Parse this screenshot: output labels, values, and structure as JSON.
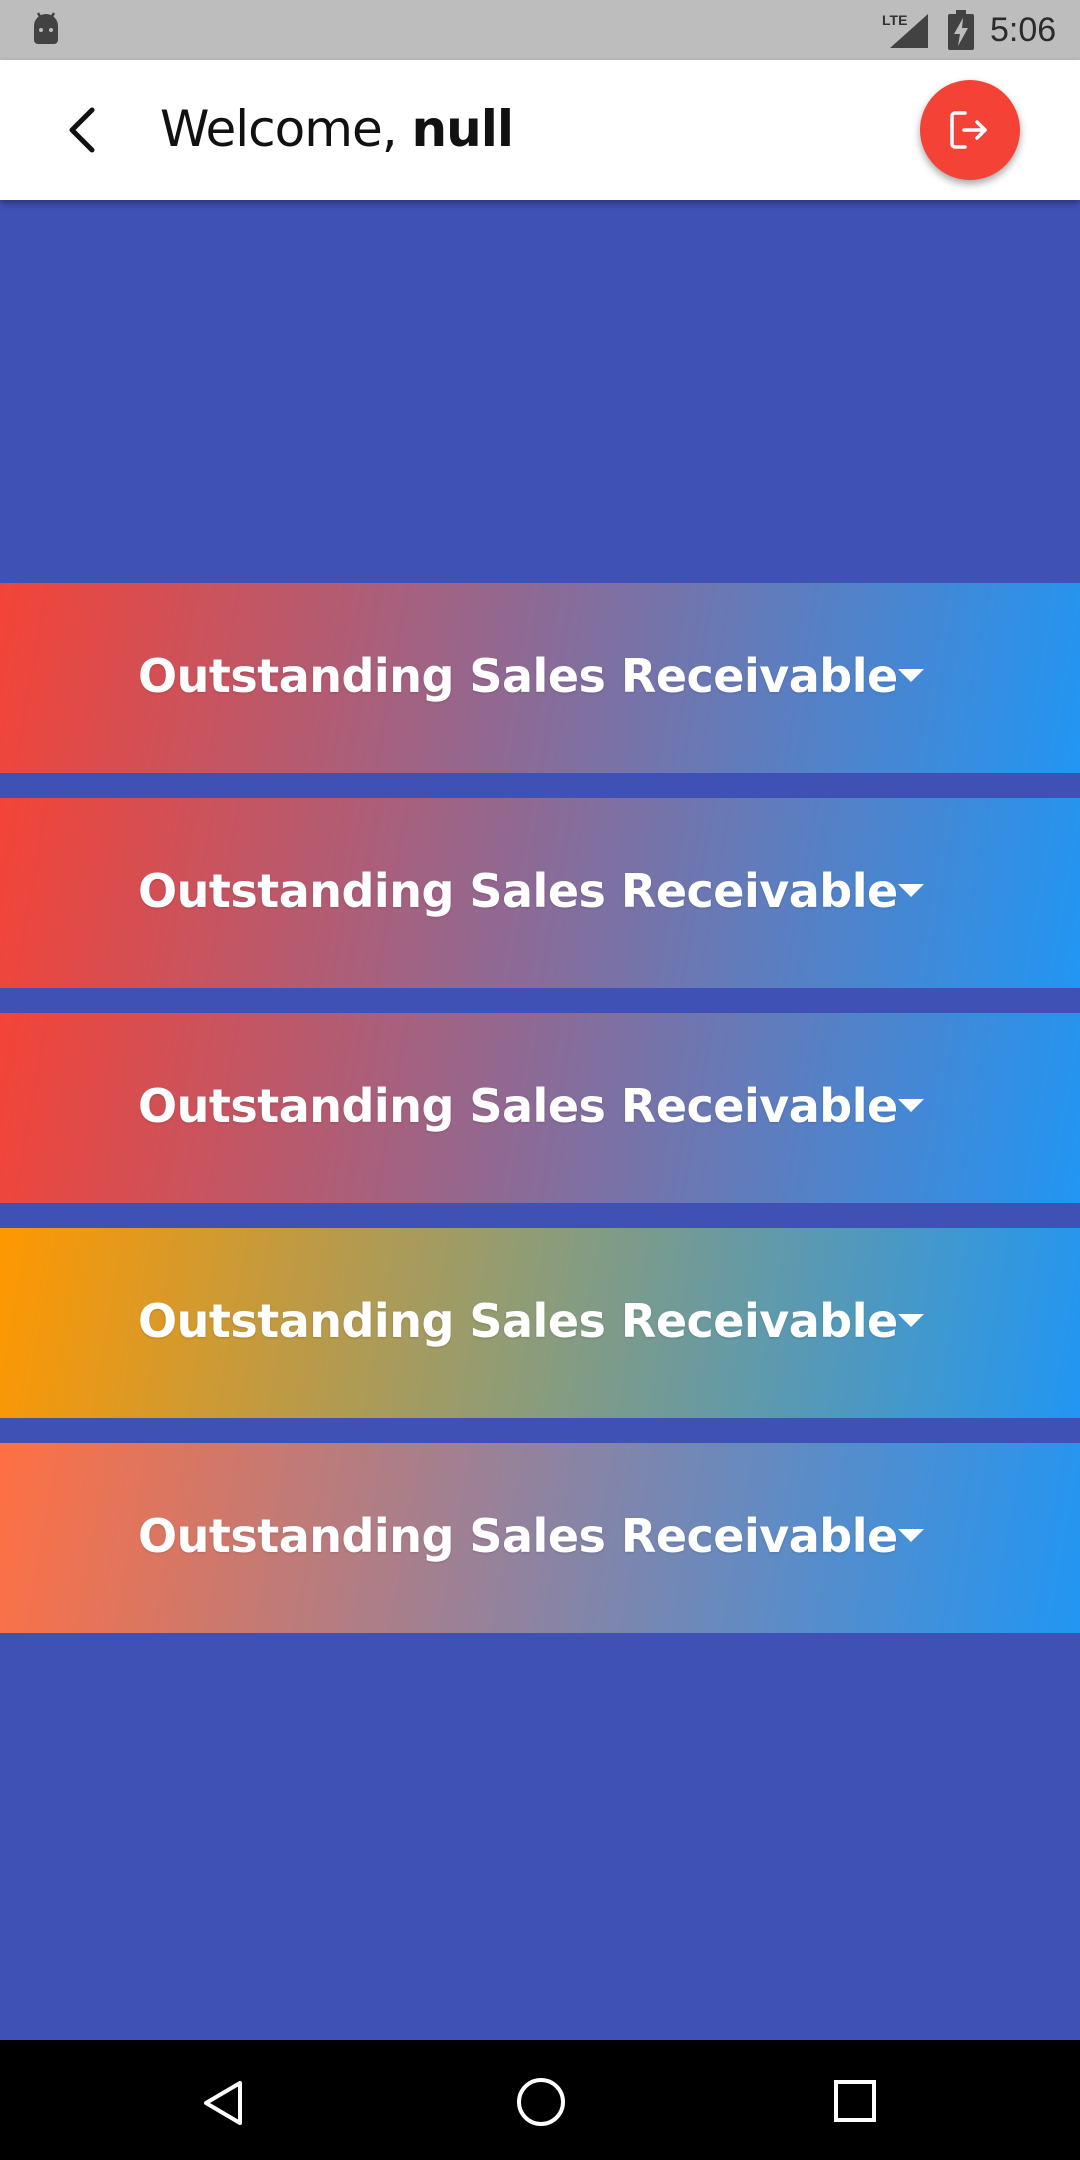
{
  "status_bar": {
    "network": "LTE",
    "time": "5:06",
    "icons": [
      "android-icon",
      "signal-icon",
      "battery-charging-icon"
    ]
  },
  "app_bar": {
    "welcome_prefix": "Welcome,",
    "user_name": "null",
    "back_icon": "back-arrow-icon",
    "logout_icon": "logout-icon",
    "logout_color": "#f44336"
  },
  "cards": [
    {
      "title": "Outstanding Sales Receivable",
      "gradient_start": "#f44336",
      "gradient_end": "#2196f3"
    },
    {
      "title": "Outstanding Sales Receivable",
      "gradient_start": "#f44336",
      "gradient_end": "#2196f3"
    },
    {
      "title": "Outstanding Sales Receivable",
      "gradient_start": "#f44336",
      "gradient_end": "#2196f3"
    },
    {
      "title": "Outstanding Sales Receivable",
      "gradient_start": "#ff9800",
      "gradient_end": "#2196f3"
    },
    {
      "title": "Outstanding Sales Receivable",
      "gradient_start": "#ff7043",
      "gradient_end": "#2196f3"
    }
  ],
  "colors": {
    "background": "#3f51b5",
    "app_bar": "#ffffff",
    "status_bar": "#bdbdbd"
  },
  "nav_bar": {
    "icons": [
      "nav-back-icon",
      "nav-home-icon",
      "nav-recents-icon"
    ]
  }
}
